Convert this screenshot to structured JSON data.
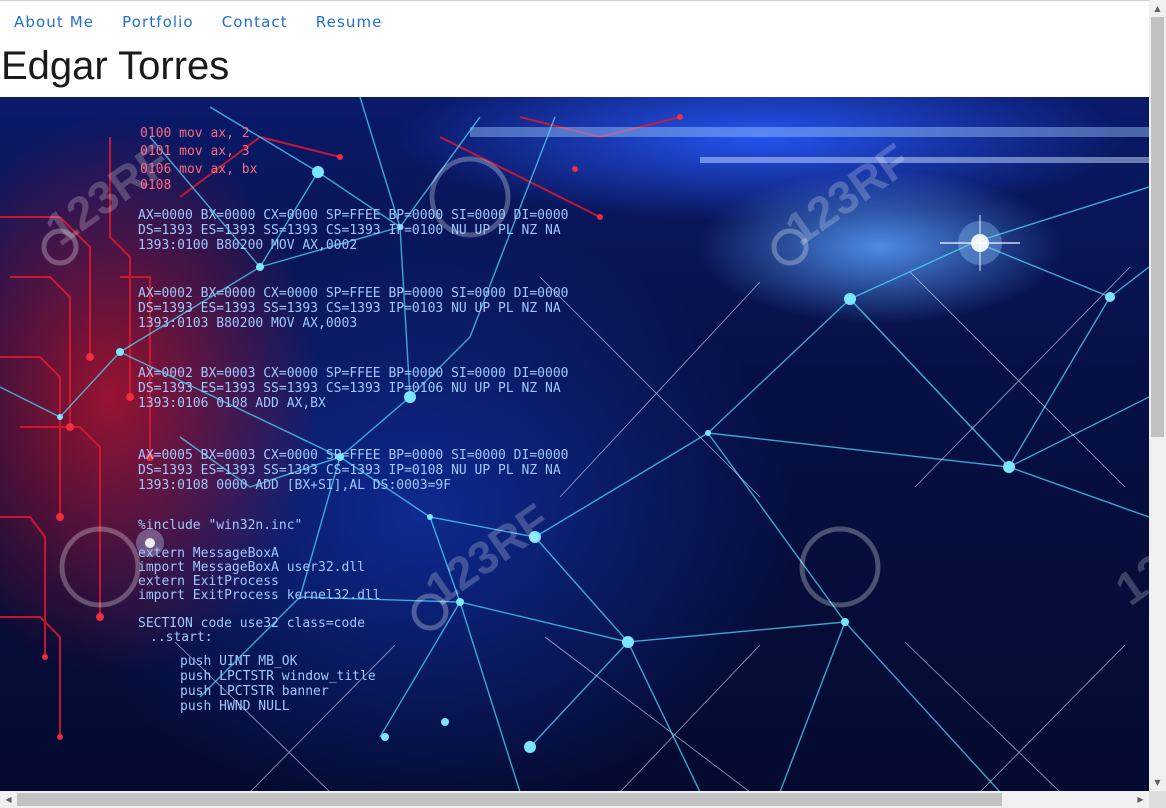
{
  "nav": {
    "items": [
      {
        "label": "About Me"
      },
      {
        "label": "Portfolio"
      },
      {
        "label": "Contact"
      },
      {
        "label": "Resume"
      }
    ]
  },
  "header": {
    "title": "Edgar Torres"
  },
  "hero": {
    "code_lines": [
      "0100 mov ax, 2",
      "0101 mov ax, 3",
      "0106 mov ax, bx",
      "0108",
      "AX=0000 BX=0000 CX=0000 SP=FFEE BP=0000 SI=0000 DI=0000",
      "DS=1393 ES=1393 SS=1393 CS=1393 IP=0100 NU UP PL NZ NA",
      "1393:0100 B80200 MOV AX,0002",
      "AX=0002 BX=0000 CX=0000 SP=FFEE BP=0000 SI=0000 DI=0000",
      "DS=1393 ES=1393 SS=1393 CS=1393 IP=0103 NU UP PL NZ NA",
      "1393:0103 B80200 MOV AX,0003",
      "AX=0002 BX=0003 CX=0000 SP=FFEE BP=0000 SI=0000 DI=0000",
      "DS=1393 ES=1393 SS=1393 CS=1393 IP=0106 NU UP PL NZ NA",
      "1393:0106 0108 ADD AX,BX",
      "AX=0005 BX=0003 CX=0000 SP=FFEE BP=0000 SI=0000 DI=0000",
      "DS=1393 ES=1393 SS=1393 CS=1393 IP=0108 NU UP PL NZ NA",
      "1393:0108 0000 ADD [BX+SI],AL DS:0003=9F",
      "%include \"win32n.inc\"",
      "extern MessageBoxA",
      "import MessageBoxA user32.dll",
      "extern ExitProcess",
      "import ExitProcess kernel32.dll",
      "SECTION code use32 class=code",
      "..start:",
      "push UINT MB_OK",
      "push LPCTSTR window_title",
      "push LPCTSTR banner",
      "push HWND NULL"
    ],
    "watermark": "123RF"
  },
  "colors": {
    "nav_link": "#1f6fd0",
    "title": "#1a1a1a",
    "hero_dark": "#040a30",
    "hero_glow": "#5aa0ff",
    "node": "#4fd8ff",
    "red_accent": "#e01830"
  }
}
